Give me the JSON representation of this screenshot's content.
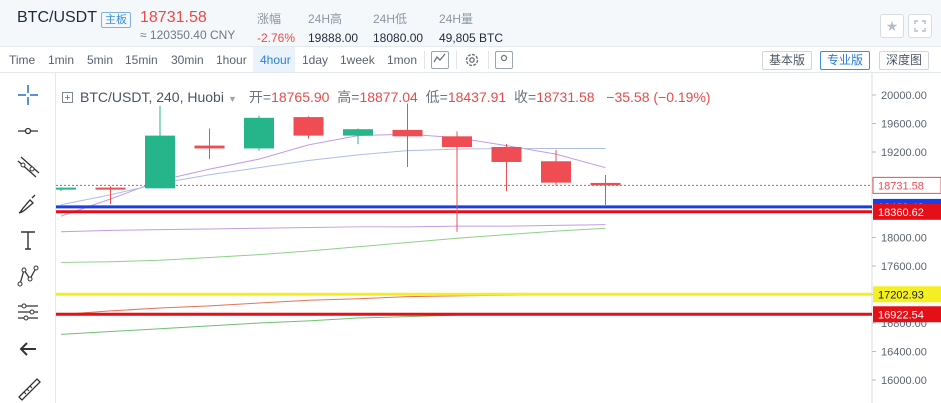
{
  "header": {
    "pair": "BTC/USDT",
    "badge": "主板",
    "price": "18731.58",
    "cny": "≈ 120350.40 CNY",
    "stats": [
      {
        "label": "涨幅",
        "value": "-2.76%"
      },
      {
        "label": "24H高",
        "value": "19888.00"
      },
      {
        "label": "24H低",
        "value": "18080.00"
      },
      {
        "label": "24H量",
        "value": "49,805 BTC"
      }
    ]
  },
  "toolbar": {
    "timeframes": [
      "Time",
      "1min",
      "5min",
      "15min",
      "30min",
      "1hour",
      "4hour",
      "1day",
      "1week",
      "1mon"
    ],
    "active_timeframe": "4hour",
    "views": [
      "基本版",
      "专业版",
      "深度图"
    ],
    "active_view": "专业版"
  },
  "legend": {
    "symbol": "BTC/USDT, 240, Huobi",
    "open_label": "开=",
    "open": "18765.90",
    "high_label": "高=",
    "high": "18877.04",
    "low_label": "低=",
    "low": "18437.91",
    "close_label": "收=",
    "close": "18731.58",
    "change": "−35.58 (−0.19%)"
  },
  "left_tools": [
    "crosshair-icon",
    "horizontal-line-icon",
    "trend-lines-icon",
    "brush-icon",
    "text-icon",
    "pattern-icon",
    "fibonacci-icon",
    "back-arrow-icon",
    "ruler-icon"
  ],
  "colors": {
    "up": "#26b58a",
    "down": "#f04c54",
    "accent": "#2c7fd8"
  },
  "chart_data": {
    "type": "candlestick",
    "price_axis_ticks": [
      20000,
      19600,
      19200,
      18800,
      18400,
      18000,
      17600,
      17200,
      16800,
      16400,
      16000
    ],
    "candles": [
      {
        "o": 18680,
        "h": 18700,
        "l": 18650,
        "c": 18700
      },
      {
        "o": 18700,
        "h": 18720,
        "l": 18470,
        "c": 18690
      },
      {
        "o": 18690,
        "h": 19850,
        "l": 18690,
        "c": 19430
      },
      {
        "o": 19290,
        "h": 19530,
        "l": 19100,
        "c": 19250
      },
      {
        "o": 19250,
        "h": 19710,
        "l": 19220,
        "c": 19680
      },
      {
        "o": 19690,
        "h": 19700,
        "l": 19390,
        "c": 19430
      },
      {
        "o": 19430,
        "h": 19530,
        "l": 19310,
        "c": 19520
      },
      {
        "o": 19510,
        "h": 19880,
        "l": 18990,
        "c": 19420
      },
      {
        "o": 19420,
        "h": 19490,
        "l": 18080,
        "c": 19270
      },
      {
        "o": 19270,
        "h": 19310,
        "l": 18650,
        "c": 19060
      },
      {
        "o": 19070,
        "h": 19230,
        "l": 18730,
        "c": 18770
      },
      {
        "o": 18765.9,
        "h": 18877.04,
        "l": 18437.91,
        "c": 18731.58
      }
    ],
    "ma_lines": [
      {
        "color": "#c49be6",
        "points": [
          18080,
          18100,
          18110,
          18120,
          18130,
          18140,
          18150,
          18150,
          18160,
          18160,
          18170,
          18180
        ]
      },
      {
        "color": "#c49be6",
        "points": [
          18300,
          18540,
          18800,
          18960,
          19100,
          19300,
          19430,
          19450,
          19400,
          19290,
          19170,
          18980
        ]
      },
      {
        "color": "#aebde9",
        "points": null,
        "values": [
          18460,
          18600,
          18760,
          18880,
          18980,
          19080,
          19160,
          19220,
          19240,
          19250,
          19250,
          19250
        ]
      },
      {
        "color": "#8fd08a",
        "points": [
          17650,
          17660,
          17680,
          17720,
          17760,
          17810,
          17870,
          17930,
          17990,
          18040,
          18090,
          18130
        ]
      },
      {
        "color": "#e8715a",
        "points": [
          16920,
          16970,
          17010,
          17040,
          17080,
          17120,
          17140,
          17170,
          17180,
          17190,
          17200,
          17210
        ]
      },
      {
        "color": "#6fbf74",
        "points": [
          16640,
          16680,
          16720,
          16760,
          16800,
          16830,
          16870,
          16890,
          16910,
          16920,
          16930,
          16930
        ]
      }
    ],
    "horizontal_lines": [
      {
        "value": 18429.43,
        "color": "#1640e8",
        "label": "18429.43"
      },
      {
        "value": 18360.62,
        "color": "#e40f17",
        "label": "18360.62"
      },
      {
        "value": 17202.93,
        "color": "#f4ef22",
        "label": "17202.93"
      },
      {
        "value": 16922.54,
        "color": "#e40f17",
        "label": "16922.54"
      }
    ],
    "last_price": {
      "value": 18731.58,
      "label": "18731.58",
      "color": "#f04c54"
    }
  }
}
